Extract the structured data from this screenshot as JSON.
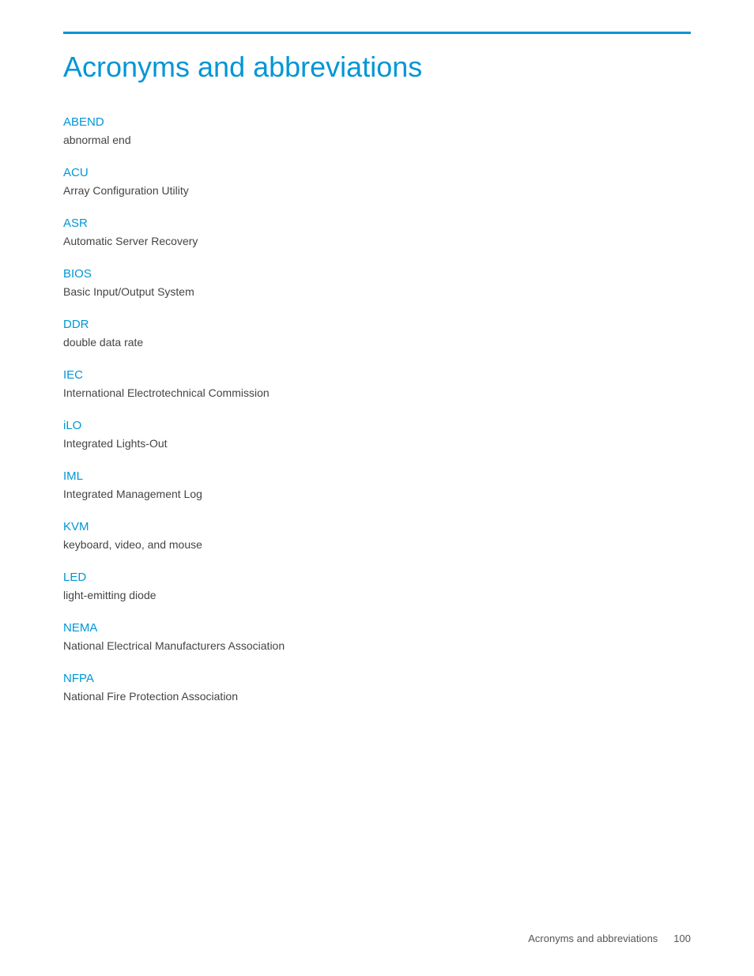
{
  "page": {
    "title": "Acronyms and abbreviations",
    "accent_color": "#0096d6"
  },
  "acronyms": [
    {
      "term": "ABEND",
      "definition": "abnormal end"
    },
    {
      "term": "ACU",
      "definition": "Array Configuration Utility"
    },
    {
      "term": "ASR",
      "definition": "Automatic Server Recovery"
    },
    {
      "term": "BIOS",
      "definition": "Basic Input/Output System"
    },
    {
      "term": "DDR",
      "definition": "double data rate"
    },
    {
      "term": "IEC",
      "definition": "International Electrotechnical Commission"
    },
    {
      "term": "iLO",
      "definition": "Integrated Lights-Out"
    },
    {
      "term": "IML",
      "definition": "Integrated Management Log"
    },
    {
      "term": "KVM",
      "definition": "keyboard, video, and mouse"
    },
    {
      "term": "LED",
      "definition": "light-emitting diode"
    },
    {
      "term": "NEMA",
      "definition": "National Electrical Manufacturers Association"
    },
    {
      "term": "NFPA",
      "definition": "National Fire Protection Association"
    }
  ],
  "footer": {
    "section_label": "Acronyms and abbreviations",
    "page_number": "100"
  }
}
